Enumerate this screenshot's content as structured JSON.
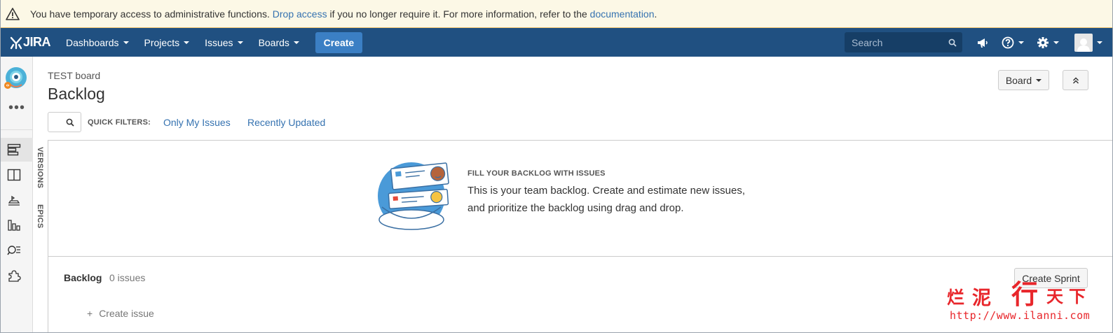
{
  "banner": {
    "icon": "warning-icon",
    "text_before": "You have temporary access to administrative functions.",
    "link_drop": "Drop access",
    "text_middle": "if you no longer require it. For more information, refer to the",
    "link_docs": "documentation",
    "text_end": "."
  },
  "nav": {
    "logo_text": "JIRA",
    "items": [
      {
        "label": "Dashboards"
      },
      {
        "label": "Projects"
      },
      {
        "label": "Issues"
      },
      {
        "label": "Boards"
      }
    ],
    "create_label": "Create",
    "search_placeholder": "Search",
    "colors": {
      "bar": "#205081",
      "create": "#3b7fc4"
    }
  },
  "sidebar": {
    "icons": [
      "backlog-icon",
      "board-icon",
      "releases-icon",
      "reports-icon",
      "issues-icon",
      "add-ons-icon"
    ]
  },
  "side_tabs": [
    "VERSIONS",
    "EPICS"
  ],
  "header": {
    "board_name": "TEST board",
    "title": "Backlog",
    "board_button": "Board"
  },
  "filters": {
    "label": "QUICK FILTERS:",
    "items": [
      "Only My Issues",
      "Recently Updated"
    ]
  },
  "empty_state": {
    "title": "FILL YOUR BACKLOG WITH ISSUES",
    "line1": "This is your team backlog. Create and estimate new issues,",
    "line2": "and prioritize the backlog using drag and drop."
  },
  "backlog": {
    "title": "Backlog",
    "count": "0 issues",
    "create_sprint": "Create Sprint",
    "create_issue": "Create issue"
  },
  "watermark": {
    "chars": [
      "烂",
      "泥",
      "行",
      "天",
      "下"
    ],
    "url": "http://www.ilanni.com"
  }
}
